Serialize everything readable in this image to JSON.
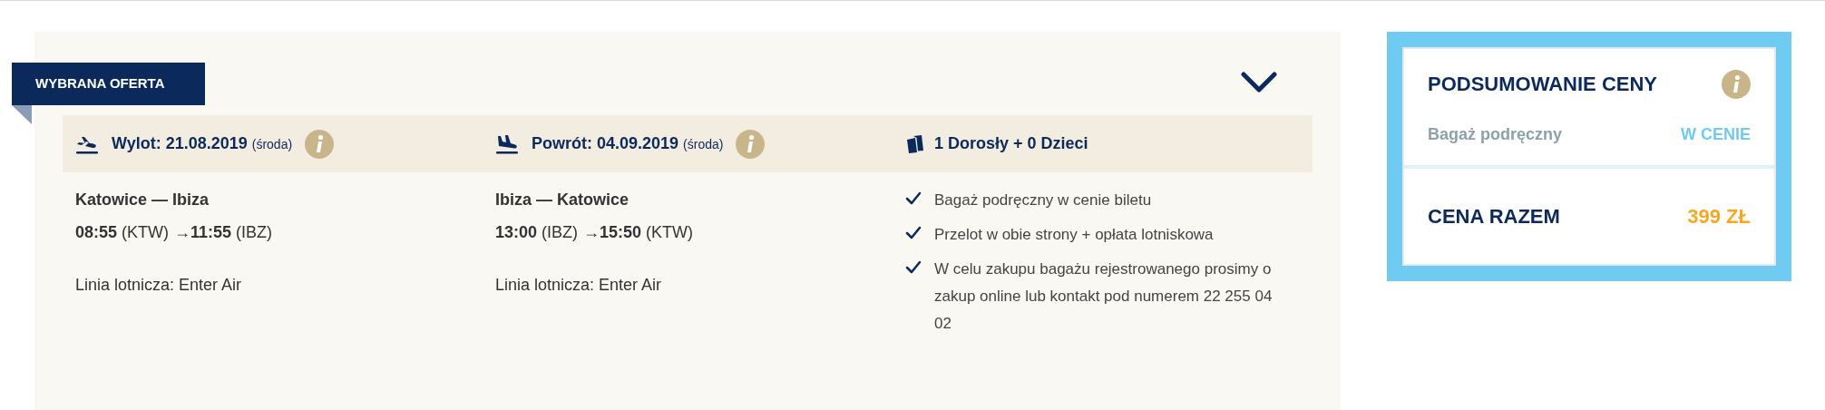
{
  "badge": "WYBRANA OFERTA",
  "flights": [
    {
      "kind": "departure",
      "label": "Wylot: 21.08.2019",
      "day": "(środa)",
      "route": "Katowice — Ibiza",
      "depart_time": "08:55",
      "depart_code": "(KTW)",
      "arrow": "→",
      "arrive_time": "11:55",
      "arrive_code": "(IBZ)",
      "airline": "Linia lotnicza: Enter Air"
    },
    {
      "kind": "return",
      "label": "Powrót: 04.09.2019",
      "day": "(środa)",
      "route": "Ibiza — Katowice",
      "depart_time": "13:00",
      "depart_code": "(IBZ)",
      "arrow": "→",
      "arrive_time": "15:50",
      "arrive_code": "(KTW)",
      "airline": "Linia lotnicza: Enter Air"
    }
  ],
  "passengers": "1 Dorosły + 0 Dzieci",
  "included": [
    "Bagaż podręczny w cenie biletu",
    "Przelot w obie strony + opłata lotniskowa",
    "W celu zakupu bagażu rejestrowanego prosimy o zakup online lub kontakt pod numerem 22 255 04 02"
  ],
  "summary": {
    "title": "PODSUMOWANIE CENY",
    "rows": [
      {
        "label": "Bagaż podręczny",
        "value": "W CENIE"
      }
    ],
    "total_label": "CENA RAZEM",
    "total_value": "399 ZŁ"
  }
}
